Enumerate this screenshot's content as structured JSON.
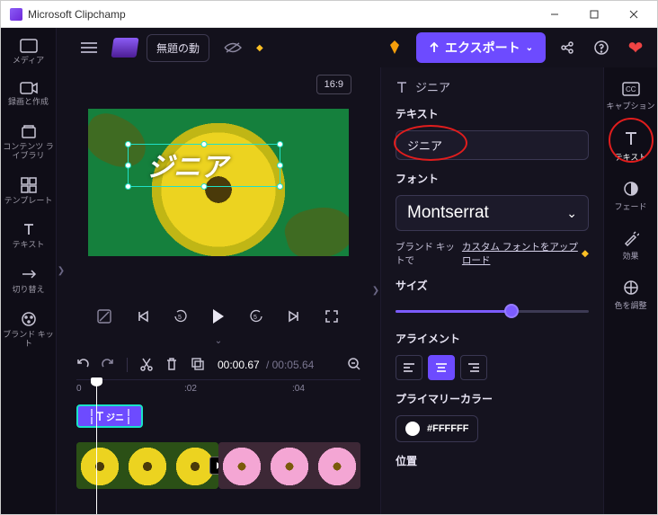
{
  "window": {
    "title": "Microsoft Clipchamp"
  },
  "topbar": {
    "project_title": "無題の動",
    "export_label": "エクスポート"
  },
  "left_tabs": {
    "media": "メディア",
    "record": "録画と作成",
    "library": "コンテンツ ライブラリ",
    "templates": "テンプレート",
    "text": "テキスト",
    "transitions": "切り替え",
    "brandkit": "ブランド キット"
  },
  "stage": {
    "aspect": "16:9",
    "overlay_text": "ジニア"
  },
  "timeline": {
    "time_current": "00:00.67",
    "time_duration": "00:05.64",
    "ruler": {
      "t0": "0",
      "t1": ":02",
      "t2": ":04"
    },
    "text_clip_label": "ジニ"
  },
  "props": {
    "crumb": "ジニア",
    "text_label": "テキスト",
    "text_value": "ジニア",
    "font_label": "フォント",
    "font_value": "Montserrat",
    "upload_prefix": "ブランド キットで",
    "upload_link": "カスタム フォントをアップロード",
    "size_label": "サイズ",
    "align_label": "アライメント",
    "primary_label": "プライマリーカラー",
    "primary_value": "#FFFFFF",
    "position_label": "位置"
  },
  "right_tabs": {
    "captions": "キャプション",
    "text": "テキスト",
    "fade": "フェード",
    "effects": "効果",
    "color": "色を調整"
  }
}
